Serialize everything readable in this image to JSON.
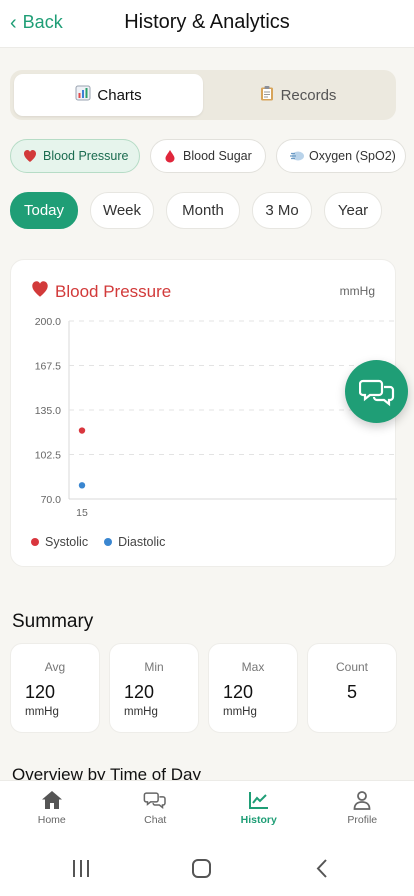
{
  "header": {
    "back_label": "Back",
    "title": "History & Analytics"
  },
  "segment": {
    "charts_label": "Charts",
    "records_label": "Records",
    "active": "charts"
  },
  "metrics": [
    {
      "label": "Blood Pressure",
      "icon": "heart-icon",
      "active": true
    },
    {
      "label": "Blood Sugar",
      "icon": "blood-drop-icon",
      "active": false
    },
    {
      "label": "Oxygen (SpO2)",
      "icon": "oxygen-icon",
      "active": false
    }
  ],
  "ranges": [
    {
      "label": "Today",
      "active": true
    },
    {
      "label": "Week",
      "active": false
    },
    {
      "label": "Month",
      "active": false
    },
    {
      "label": "3 Mo",
      "active": false
    },
    {
      "label": "Year",
      "active": false
    }
  ],
  "chart_card": {
    "title": "Blood Pressure",
    "unit": "mmHg"
  },
  "chart_data": {
    "type": "scatter",
    "ylim": [
      70.0,
      200.0
    ],
    "y_ticks": [
      "200.0",
      "167.5",
      "135.0",
      "102.5",
      "70.0"
    ],
    "x_ticks": [
      "15"
    ],
    "series": [
      {
        "name": "Systolic",
        "color": "#d9363e",
        "points": [
          {
            "x": "15",
            "y": 120
          }
        ]
      },
      {
        "name": "Diastolic",
        "color": "#3a86d0",
        "points": [
          {
            "x": "15",
            "y": 80
          }
        ]
      }
    ],
    "grid": true,
    "legend": "bottom-left"
  },
  "summary": {
    "title": "Summary",
    "stats": [
      {
        "label": "Avg",
        "value": "120",
        "unit": "mmHg"
      },
      {
        "label": "Min",
        "value": "120",
        "unit": "mmHg"
      },
      {
        "label": "Max",
        "value": "120",
        "unit": "mmHg"
      },
      {
        "label": "Count",
        "value": "5",
        "unit": ""
      }
    ]
  },
  "overview_title": "Overview by Time of Day",
  "nav": [
    {
      "label": "Home",
      "icon": "home-icon",
      "active": false
    },
    {
      "label": "Chat",
      "icon": "chat-icon",
      "active": false
    },
    {
      "label": "History",
      "icon": "chart-line-icon",
      "active": true
    },
    {
      "label": "Profile",
      "icon": "profile-icon",
      "active": false
    }
  ],
  "colors": {
    "accent": "#1f9e76",
    "systolic": "#d9363e",
    "diastolic": "#3a86d0"
  }
}
